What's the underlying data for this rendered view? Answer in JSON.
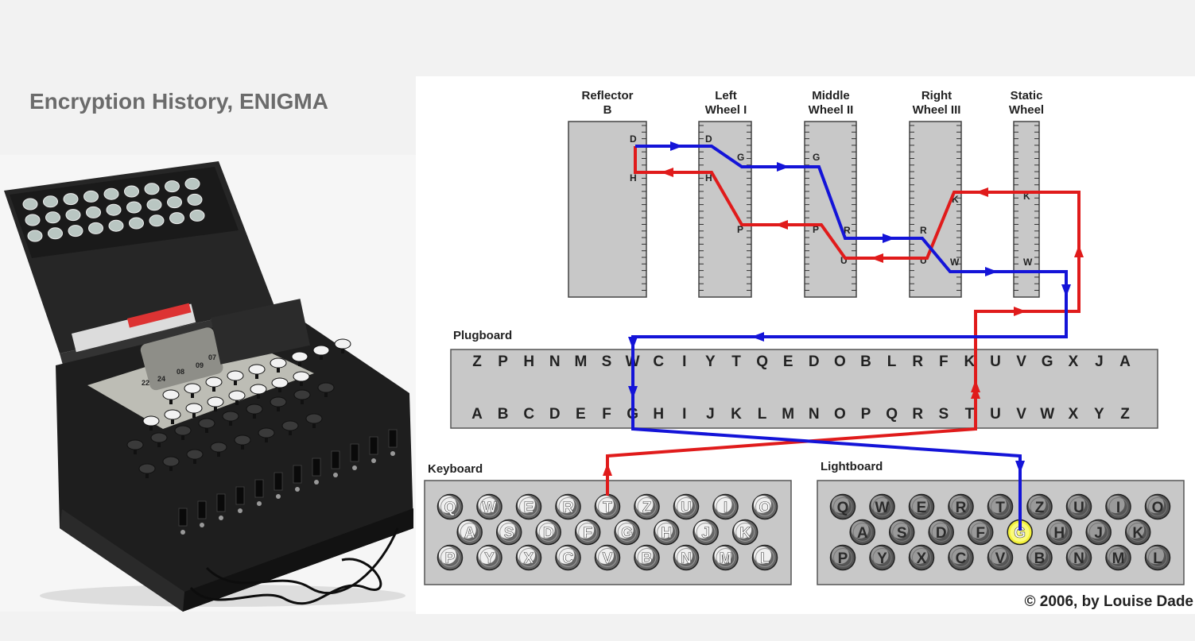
{
  "slide": {
    "title": "Encryption History, ENIGMA"
  },
  "photo": {
    "rotor_numbers": [
      "22",
      "24",
      "08",
      "09",
      "07"
    ]
  },
  "diagram": {
    "rotors": [
      {
        "line1": "Reflector",
        "line2": "B",
        "marks": [
          "D",
          "H"
        ]
      },
      {
        "line1": "Left",
        "line2": "Wheel I",
        "marks": [
          "D",
          "H",
          "G",
          "P"
        ]
      },
      {
        "line1": "Middle",
        "line2": "Wheel II",
        "marks": [
          "G",
          "P",
          "R",
          "U"
        ]
      },
      {
        "line1": "Right",
        "line2": "Wheel III",
        "marks": [
          "K",
          "R",
          "U",
          "W"
        ]
      },
      {
        "line1": "Static",
        "line2": "Wheel",
        "marks": [
          "K",
          "W"
        ]
      }
    ],
    "plugboard": {
      "label": "Plugboard",
      "top_row": [
        "Z",
        "P",
        "H",
        "N",
        "M",
        "S",
        "W",
        "C",
        "I",
        "Y",
        "T",
        "Q",
        "E",
        "D",
        "O",
        "B",
        "L",
        "R",
        "F",
        "K",
        "U",
        "V",
        "G",
        "X",
        "J",
        "A"
      ],
      "bottom_row": [
        "A",
        "B",
        "C",
        "D",
        "E",
        "F",
        "G",
        "H",
        "I",
        "J",
        "K",
        "L",
        "M",
        "N",
        "O",
        "P",
        "Q",
        "R",
        "S",
        "T",
        "U",
        "V",
        "W",
        "X",
        "Y",
        "Z"
      ]
    },
    "keyboard": {
      "label": "Keyboard",
      "rows": [
        [
          "Q",
          "W",
          "E",
          "R",
          "T",
          "Z",
          "U",
          "I",
          "O"
        ],
        [
          "A",
          "S",
          "D",
          "F",
          "G",
          "H",
          "J",
          "K"
        ],
        [
          "P",
          "Y",
          "X",
          "C",
          "V",
          "B",
          "N",
          "M",
          "L"
        ]
      ],
      "pressed": "T"
    },
    "lightboard": {
      "label": "Lightboard",
      "rows": [
        [
          "Q",
          "W",
          "E",
          "R",
          "T",
          "Z",
          "U",
          "I",
          "O"
        ],
        [
          "A",
          "S",
          "D",
          "F",
          "G",
          "H",
          "J",
          "K"
        ],
        [
          "P",
          "Y",
          "X",
          "C",
          "V",
          "B",
          "N",
          "M",
          "L"
        ]
      ],
      "lit": "G"
    },
    "credit": "© 2006, by Louise Dade",
    "colors": {
      "forward_path": "#e01b1b",
      "return_path": "#1414d8",
      "lamp_lit": "#f3f13a",
      "panel": "#c8c8c8"
    }
  }
}
